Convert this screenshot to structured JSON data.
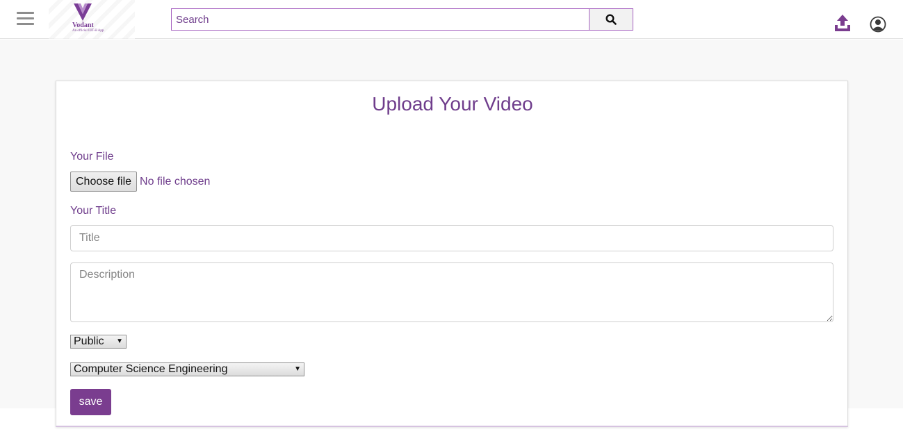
{
  "header": {
    "brand_name": "Vodant",
    "brand_tagline": "An official IIIT-H App",
    "menu_icon": "hamburger-icon",
    "search": {
      "placeholder": "Search",
      "value": "",
      "button_icon": "search-icon"
    },
    "upload_icon": "upload-icon",
    "profile_icon": "user-circle-icon"
  },
  "upload_form": {
    "heading": "Upload Your Video",
    "file_label": "Your File",
    "file_button": "Choose file",
    "file_status": "No file chosen",
    "title_label": "Your Title",
    "title_placeholder": "Title",
    "description_placeholder": "Description",
    "privacy_selected": "Public",
    "category_selected": "Computer Science Engineering",
    "save_label": "save"
  },
  "colors": {
    "accent": "#6f3d8c",
    "button": "#7a3d8f",
    "page_background": "#f8f8f8"
  }
}
